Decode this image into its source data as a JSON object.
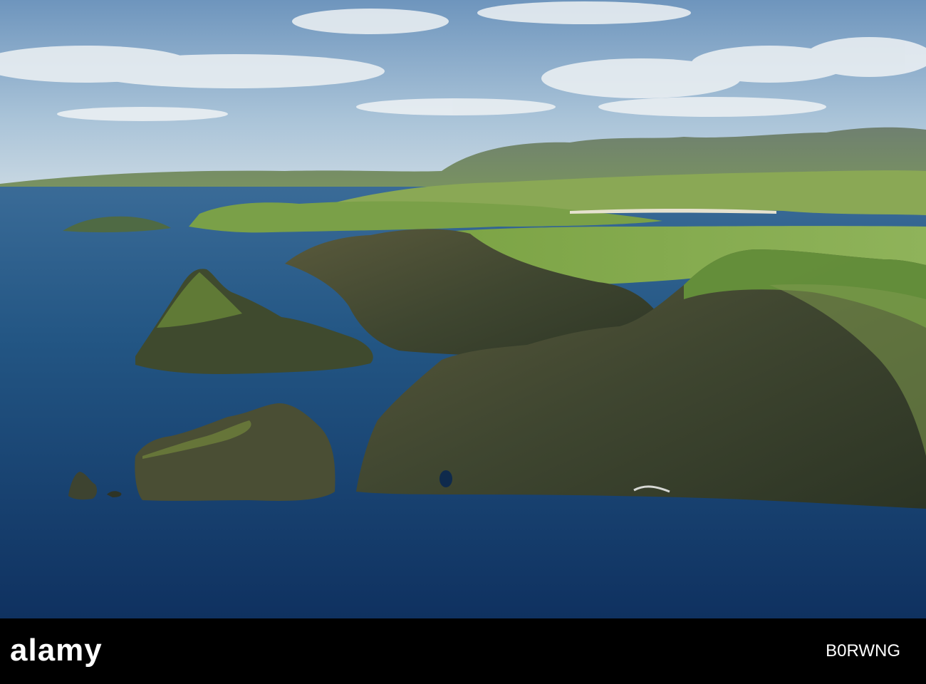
{
  "watermark": {
    "brand": "alamy",
    "code": "B0RWNG"
  },
  "scene": {
    "sky": "#b9cfe2",
    "sea": "#1f4f7e",
    "grass": "#6f9a3a",
    "rock": "#4a4a36"
  }
}
